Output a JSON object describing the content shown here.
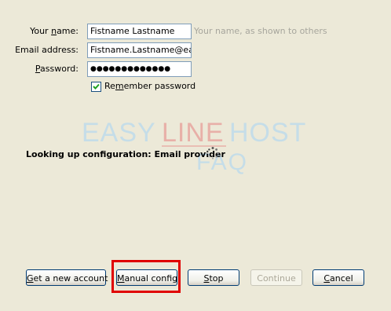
{
  "form": {
    "name_label_pre": "Your ",
    "name_label_ul": "n",
    "name_label_post": "ame:",
    "name_value": "Fistname Lastname",
    "name_hint": "Your name, as shown to others",
    "email_label": "Email address:",
    "email_value": "Fistname.Lastname@eas",
    "password_label_ul": "P",
    "password_label_post": "assword:",
    "password_value": "●●●●●●●●●●●●●",
    "remember_checked": true,
    "remember_label_pre": "Re",
    "remember_label_ul": "m",
    "remember_label_post": "ember password"
  },
  "watermark": {
    "line1_a": "EASY",
    "line1_b": "LINE",
    "line1_c": "HOST",
    "line2": "FAQ"
  },
  "status": {
    "text": "Looking up configuration: Email provider"
  },
  "buttons": {
    "get_account_ul": "G",
    "get_account_post": "et a new account",
    "manual_ul": "M",
    "manual_post": "anual config",
    "stop_ul": "S",
    "stop_post": "top",
    "continue_label": "Continue",
    "cancel_ul": "C",
    "cancel_post": "ancel"
  },
  "colors": {
    "background": "#ECE9D8",
    "highlight": "#E00000",
    "watermark_blue": "#C5DDE8",
    "watermark_red": "#E8B0A8"
  }
}
